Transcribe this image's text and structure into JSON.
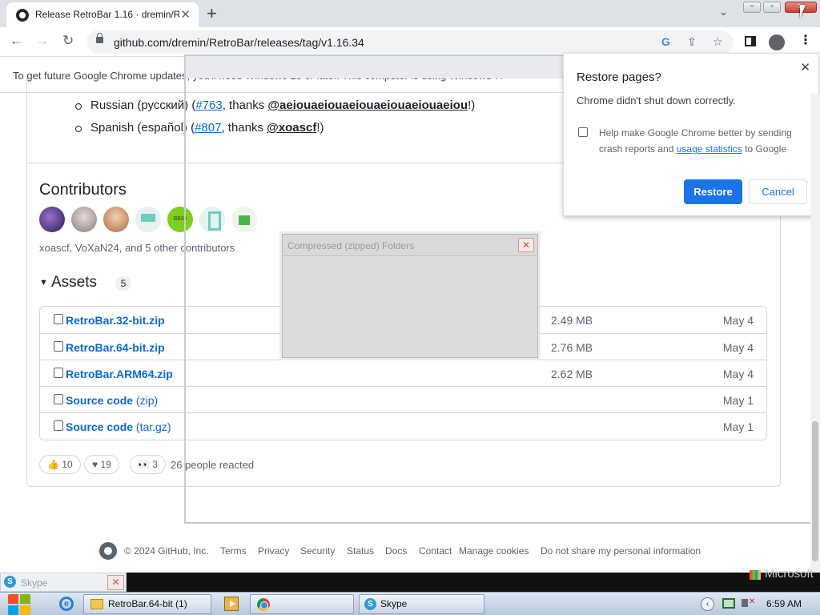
{
  "browser": {
    "tab_title": "Release RetroBar 1.16 · dremin/R",
    "url": "github.com/dremin/RetroBar/releases/tag/v1.16.34",
    "infobar_text": "To get future Google Chrome updates, you'll need Windows 10 or later. This computer is using Windows 7."
  },
  "translations": {
    "russian": {
      "lang": "Russian (русский) (",
      "pr": "#763",
      "mid": ", thanks ",
      "user": "@aeiouaeiouaeiouaeiouaeiouaeiou",
      "end": "!)"
    },
    "spanish": {
      "lang": "Spanish (español) (",
      "pr": "#807",
      "mid": ", thanks ",
      "user": "@xoascf",
      "end": "!)"
    }
  },
  "contributors": {
    "heading": "Contributors",
    "summary": "xoascf, VoXaN24, and 5 other contributors",
    "avatar5_text": "BBIO"
  },
  "assets": {
    "heading": "Assets",
    "count": "5",
    "rows": [
      {
        "name": "RetroBar.32-bit.zip",
        "suffix": "",
        "size": "2.49 MB",
        "date": "May 4"
      },
      {
        "name": "RetroBar.64-bit.zip",
        "suffix": "",
        "size": "2.76 MB",
        "date": "May 4"
      },
      {
        "name": "RetroBar.ARM64.zip",
        "suffix": "",
        "size": "2.62 MB",
        "date": "May 4"
      },
      {
        "name": "Source code",
        "suffix": " (zip)",
        "size": "",
        "date": "May 1"
      },
      {
        "name": "Source code",
        "suffix": " (tar.gz)",
        "size": "",
        "date": "May 1"
      }
    ]
  },
  "reactions": {
    "thumbs_up": "10",
    "heart": "19",
    "eyes": "3",
    "summary": "26 people reacted"
  },
  "footer": {
    "copyright": "© 2024 GitHub, Inc.",
    "links": [
      "Terms",
      "Privacy",
      "Security",
      "Status",
      "Docs",
      "Contact",
      "Manage cookies",
      "Do not share my personal information"
    ]
  },
  "zip_dialog": {
    "title": "Compressed (zipped) Folders"
  },
  "restore_dialog": {
    "title": "Restore pages?",
    "message": "Chrome didn't shut down correctly.",
    "checkbox_pre": "Help make Google Chrome better by sending crash reports and ",
    "checkbox_link": "usage statistics",
    "checkbox_post": " to Google",
    "restore_label": "Restore",
    "cancel_label": "Cancel"
  },
  "taskbar": {
    "skype_mini_title": "Skype",
    "microsoft_text": "Microsoft",
    "folder_item": "RetroBar.64-bit (1)",
    "skype_item": "Skype",
    "clock": "6:59 AM"
  }
}
